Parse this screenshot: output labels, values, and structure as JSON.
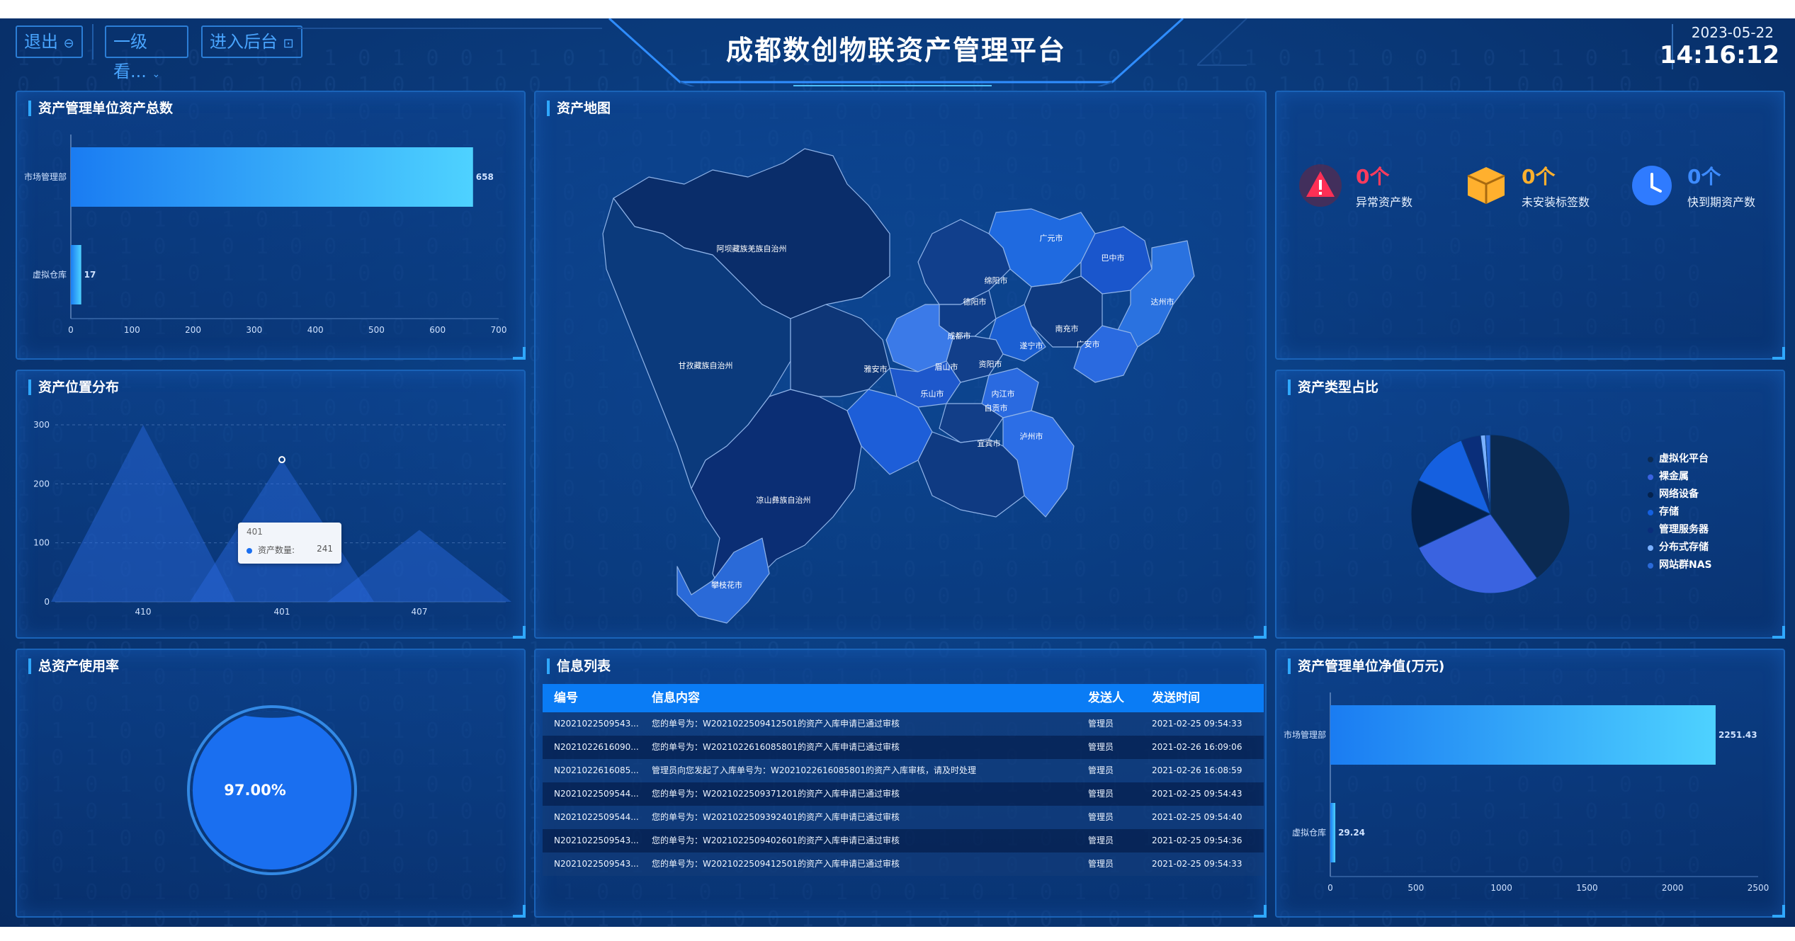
{
  "header": {
    "title": "成都数创物联资产管理平台",
    "logout_label": "退出",
    "level_select": "一级看...",
    "backend_label": "进入后台",
    "date": "2023-05-22",
    "time": "14:16:12"
  },
  "panels": {
    "unit_total": {
      "title": "资产管理单位资产总数",
      "chart_data": {
        "type": "bar",
        "orientation": "horizontal",
        "categories": [
          "市场管理部",
          "虚拟仓库"
        ],
        "values": [
          658,
          17
        ],
        "xlim": [
          0,
          700
        ],
        "xticks": [
          "0",
          "100",
          "200",
          "300",
          "400",
          "500",
          "600",
          "700"
        ],
        "value_labels": [
          "658",
          "17"
        ]
      }
    },
    "location": {
      "title": "资产位置分布",
      "chart_data": {
        "type": "area",
        "categories": [
          "410",
          "401",
          "407"
        ],
        "values": [
          300,
          241,
          122
        ],
        "ylim": [
          0,
          300
        ],
        "yticks": [
          "0",
          "100",
          "200",
          "300"
        ],
        "tooltip": {
          "title": "401",
          "series": "资产数量:",
          "value": "241"
        }
      }
    },
    "usage_rate": {
      "title": "总资产使用率",
      "value": "97.00%",
      "fraction": 0.97
    },
    "map": {
      "title": "资产地图",
      "regions": [
        "阿坝藏族羌族自治州",
        "甘孜藏族自治州",
        "凉山彝族自治州",
        "攀枝花市",
        "广元市",
        "巴中市",
        "达州市",
        "绵阳市",
        "德阳市",
        "南充市",
        "成都市",
        "遂宁市",
        "广安市",
        "资阳市",
        "雅安市",
        "眉山市",
        "乐山市",
        "内江市",
        "自贡市",
        "泸州市",
        "宜宾市"
      ]
    },
    "messages": {
      "title": "信息列表",
      "columns": [
        "编号",
        "信息内容",
        "发送人",
        "发送时间"
      ],
      "rows": [
        [
          "N2021022509543...",
          "您的单号为：W2021022509412501的资产入库申请已通过审核",
          "管理员",
          "2021-02-25 09:54:33"
        ],
        [
          "N2021022616090...",
          "您的单号为：W2021022616085801的资产入库申请已通过审核",
          "管理员",
          "2021-02-26 16:09:06"
        ],
        [
          "N2021022616085...",
          "管理员向您发起了入库单号为：W2021022616085801的资产入库审核，请及时处理",
          "管理员",
          "2021-02-26 16:08:59"
        ],
        [
          "N2021022509544...",
          "您的单号为：W2021022509371201的资产入库申请已通过审核",
          "管理员",
          "2021-02-25 09:54:43"
        ],
        [
          "N2021022509544...",
          "您的单号为：W2021022509392401的资产入库申请已通过审核",
          "管理员",
          "2021-02-25 09:54:40"
        ],
        [
          "N2021022509543...",
          "您的单号为：W2021022509402601的资产入库申请已通过审核",
          "管理员",
          "2021-02-25 09:54:36"
        ],
        [
          "N2021022509543...",
          "您的单号为：W2021022509412501的资产入库申请已通过审核",
          "管理员",
          "2021-02-25 09:54:33"
        ]
      ]
    },
    "status": {
      "items": [
        {
          "value": "0个",
          "label": "异常资产数",
          "color": "#ff3b5c",
          "icon": "warning-icon"
        },
        {
          "value": "0个",
          "label": "未安装标签数",
          "color": "#ffb02e",
          "icon": "box-icon"
        },
        {
          "value": "0个",
          "label": "快到期资产数",
          "color": "#3d8bff",
          "icon": "clock-icon"
        }
      ]
    },
    "type_ratio": {
      "title": "资产类型占比",
      "chart_data": {
        "type": "pie",
        "labels": [
          "虚拟化平台",
          "裸金属",
          "网络设备",
          "存储",
          "管理服务器",
          "分布式存储",
          "网站群NAS"
        ],
        "values": [
          40,
          28,
          14,
          12,
          4,
          1,
          1
        ],
        "colors": [
          "#0b2a52",
          "#3a63e0",
          "#04224d",
          "#1560e0",
          "#0a2e7a",
          "#7ab0ff",
          "#2a6ad8"
        ]
      }
    },
    "net_value": {
      "title": "资产管理单位净值(万元)",
      "chart_data": {
        "type": "bar",
        "orientation": "horizontal",
        "categories": [
          "市场管理部",
          "虚拟仓库"
        ],
        "values": [
          2251.43,
          29.24
        ],
        "xlim": [
          0,
          2500
        ],
        "xticks": [
          "0",
          "500",
          "1000",
          "1500",
          "2000",
          "2500"
        ],
        "value_labels": [
          "2251.43",
          "29.24"
        ]
      }
    }
  }
}
